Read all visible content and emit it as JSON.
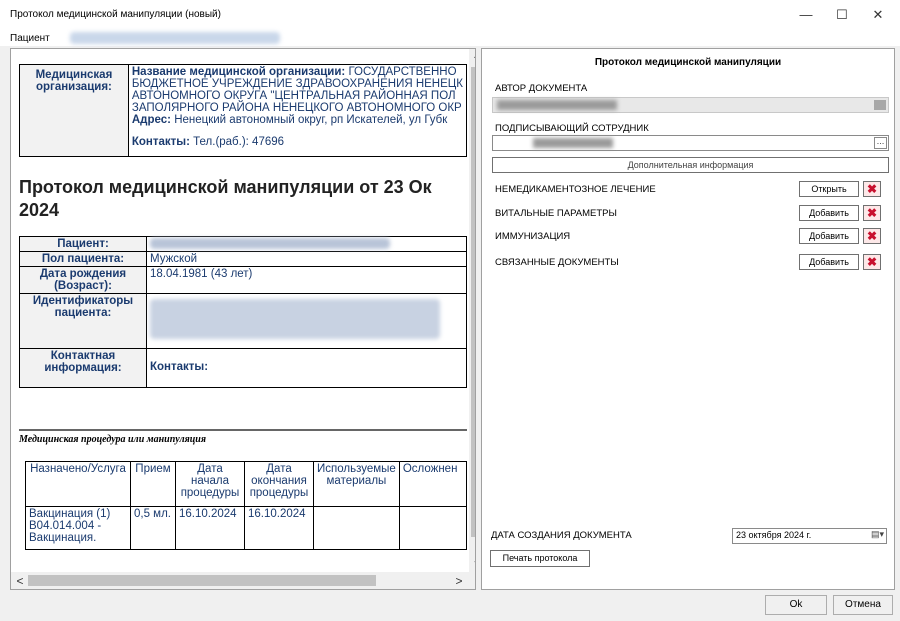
{
  "window": {
    "title": "Протокол медицинской манипуляции (новый)",
    "min": "—",
    "max": "☐",
    "close": "✕"
  },
  "menu": {
    "patient_label": "Пациент"
  },
  "document": {
    "org_label": "Медицинская организация:",
    "org_name_label": "Название медицинской организации:",
    "org_name_line1": "ГОСУДАРСТВЕННО",
    "org_name_line2": "БЮДЖЕТНОЕ УЧРЕЖДЕНИЕ ЗДРАВООХРАНЕНИЯ НЕНЕЦК",
    "org_name_line3": "АВТОНОМНОГО ОКРУГА \"ЦЕНТРАЛЬНАЯ РАЙОННАЯ ПОЛ",
    "org_name_line4": "ЗАПОЛЯРНОГО РАЙОНА НЕНЕЦКОГО АВТОНОМНОГО ОКР",
    "address_label": "Адрес:",
    "address_value": "Ненецкий автономный округ, рп Искателей, ул Губк",
    "contacts_label": "Контакты:",
    "contacts_value": "Тел.(раб.): 47696",
    "heading_line1": "Протокол медицинской манипуляции от 23 Ок",
    "heading_line2": "2024",
    "patient_label": "Пациент:",
    "sex_label": "Пол пациента:",
    "sex_value": "Мужской",
    "dob_label": "Дата рождения (Возраст):",
    "dob_value": "18.04.1981 (43 лет)",
    "ids_label": "Идентификаторы пациента:",
    "contact_info_label": "Контактная информация:",
    "contact_info_value": "Контакты:",
    "section_caption": "Медицинская процедура или манипуляция",
    "proc_headers": [
      "Назначено/Услуга",
      "Прием",
      "Дата начала процедуры",
      "Дата окончания процедуры",
      "Используемые материалы",
      "Осложнен"
    ],
    "proc_row": [
      "Вакцинация (1) B04.014.004 - Вакцинация.",
      "0,5 мл.",
      "16.10.2024",
      "16.10.2024",
      "",
      ""
    ]
  },
  "panel": {
    "title": "Протокол медицинской манипуляции",
    "author_label": "АВТОР ДОКУМЕНТА",
    "signer_label": "ПОДПИСЫВАЮЩИЙ СОТРУДНИК",
    "more_info_button": "Дополнительная информация",
    "sections": [
      {
        "label": "НЕМЕДИКАМЕНТОЗНОЕ ЛЕЧЕНИЕ",
        "button": "Открыть"
      },
      {
        "label": "ВИТАЛЬНЫЕ ПАРАМЕТРЫ",
        "button": "Добавить"
      },
      {
        "label": "ИММУНИЗАЦИЯ",
        "button": "Добавить"
      },
      {
        "label": "СВЯЗАННЫЕ ДОКУМЕНТЫ",
        "button": "Добавить"
      }
    ],
    "created_label": "ДАТА СОЗДАНИЯ ДОКУМЕНТА",
    "created_value": "23  октября  2024 г.",
    "print_button": "Печать протокола"
  },
  "footer": {
    "ok": "Ok",
    "cancel": "Отмена"
  },
  "colors": {
    "accent_text": "#1b3b6f",
    "delete_red": "#c8102e"
  }
}
